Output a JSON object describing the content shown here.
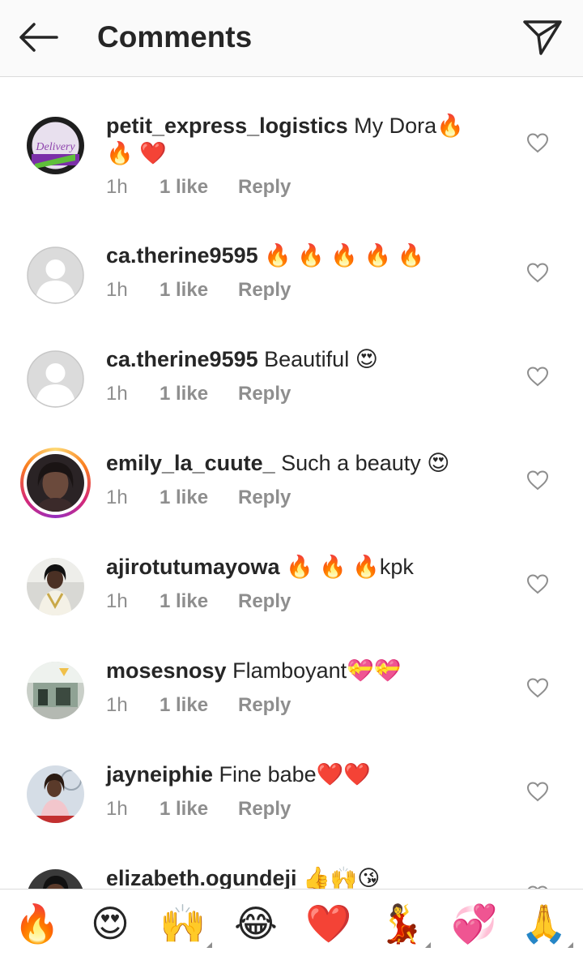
{
  "header": {
    "title": "Comments"
  },
  "comments": [
    {
      "username": "petit_express_logistics",
      "text": " My Dora🔥 🔥 ❤️",
      "time": "1h",
      "likes": "1 like",
      "reply": "Reply"
    },
    {
      "username": "ca.therine9595",
      "text": " 🔥 🔥 🔥 🔥 🔥",
      "time": "1h",
      "likes": "1 like",
      "reply": "Reply"
    },
    {
      "username": "ca.therine9595",
      "text": " Beautiful 😍",
      "time": "1h",
      "likes": "1 like",
      "reply": "Reply"
    },
    {
      "username": "emily_la_cuute_",
      "text": " Such a beauty 😍",
      "time": "1h",
      "likes": "1 like",
      "reply": "Reply"
    },
    {
      "username": "ajirotutumayowa",
      "text": " 🔥 🔥 🔥kpk",
      "time": "1h",
      "likes": "1 like",
      "reply": "Reply"
    },
    {
      "username": "mosesnosy",
      "text": " Flamboyant💝💝",
      "time": "1h",
      "likes": "1 like",
      "reply": "Reply"
    },
    {
      "username": "jayneiphie",
      "text": " Fine babe❤️❤️",
      "time": "1h",
      "likes": "1 like",
      "reply": "Reply"
    },
    {
      "username": "elizabeth.ogundeji",
      "text": " 👍🙌😘",
      "time": "",
      "likes": "",
      "reply": ""
    }
  ],
  "emoji_bar": [
    "🔥",
    "😍",
    "🙌",
    "😂",
    "❤️",
    "💃",
    "💞",
    "🙏"
  ],
  "icons": {
    "back": "arrow-left-icon",
    "send": "paper-plane-icon",
    "like": "heart-outline-icon"
  },
  "colors": {
    "text": "#262626",
    "secondary": "#8e8e8e",
    "divider": "#dbdbdb",
    "header_bg": "#fafafa"
  }
}
